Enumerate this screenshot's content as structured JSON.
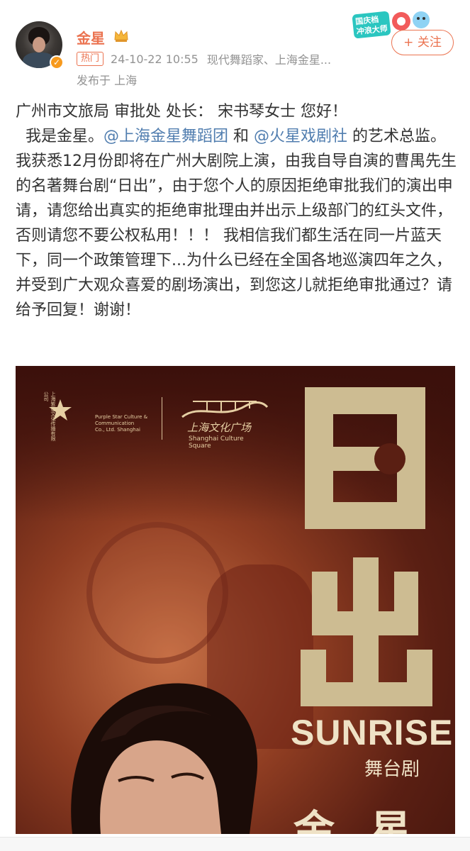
{
  "header": {
    "username": "金星",
    "hot_tag": "热门",
    "timestamp": "24-10-22 10:55",
    "source": "现代舞蹈家、上海金星...",
    "location": "发布于 上海",
    "follow_label": "+ 关注",
    "campaign_badge": "国庆档冲浪大师",
    "colors": {
      "accent": "#eb7350",
      "link": "#507daf",
      "muted": "#939393"
    }
  },
  "post": {
    "line1": "广州市文旅局 审批处 处长： 宋书琴女士 您好！",
    "line2_prefix": "  我是金星。",
    "mention1": "@上海金星舞蹈团",
    "and_word": " 和 ",
    "mention2": "@火星戏剧社",
    "body_rest": " 的艺术总监。我获悉12月份即将在广州大剧院上演，由我自导自演的曹禺先生的名著舞台剧“日出”，由于您个人的原因拒绝审批我们的演出申请，请您给出真实的拒绝审批理由并出示上级部门的红头文件，否则请您不要公权私用！！！ 我相信我们都生活在同一片蓝天下，同一个政策管理下...为什么已经在全国各地巡演四年之久，并受到广大观众喜爱的剧场演出，到您这儿就拒绝审批通过？请给予回复！谢谢！"
  },
  "poster": {
    "logo1_vertical": "上海紫星文化传播有限公司",
    "logo1_en": "Purple Star Culture &\nCommunication\nCo., Ltd. Shanghai",
    "logo2_cn": "上海文化广场",
    "logo2_en": "Shanghai Culture Square",
    "title_cn": "日出",
    "subtitle_en": "SUNRISE",
    "subtitle_cn": "舞台剧",
    "actor_name": "金星"
  }
}
